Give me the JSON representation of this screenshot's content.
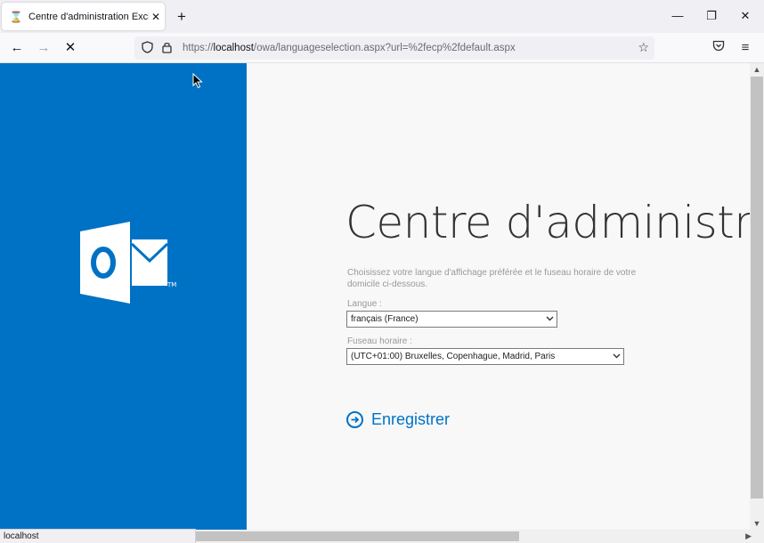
{
  "browser": {
    "tab": {
      "title": "Centre d'administration Exchange",
      "icon": "hourglass-icon"
    },
    "new_tab_label": "+",
    "window_controls": {
      "minimize": "—",
      "restore": "❐",
      "close": "✕"
    },
    "nav": {
      "back": "←",
      "forward": "→",
      "stop": "✕"
    },
    "url": {
      "scheme": "https://",
      "host": "localhost",
      "path": "/owa/languageselection.aspx?url=%2fecp%2fdefault.aspx"
    },
    "status_text": "localhost"
  },
  "page": {
    "title": "Centre d'administrat",
    "description": "Choisissez votre langue d'affichage préférée et le fuseau horaire de votre domicile ci-dessous.",
    "language": {
      "label": "Langue :",
      "selected": "français (France)"
    },
    "timezone": {
      "label": "Fuseau horaire :",
      "selected": "(UTC+01:00) Bruxelles, Copenhague, Madrid, Paris"
    },
    "save_label": "Enregistrer"
  },
  "colors": {
    "brand_blue": "#0072c6",
    "page_background": "#f8f8f8"
  }
}
